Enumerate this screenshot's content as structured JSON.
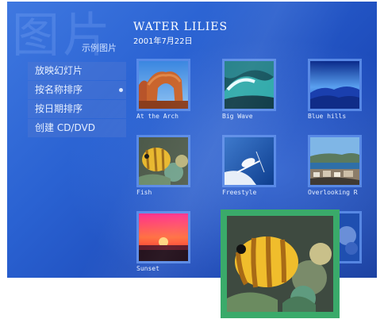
{
  "header": {
    "watermark": "图片",
    "section": "示例图片",
    "album_title": "WATER LILIES",
    "album_date": "2001年7月22日"
  },
  "menu": {
    "items": [
      {
        "label": "放映幻灯片"
      },
      {
        "label": "按名称排序",
        "selected": true
      },
      {
        "label": "按日期排序"
      },
      {
        "label": "创建 CD/DVD"
      }
    ]
  },
  "thumbnails": [
    {
      "caption": "At the Arch",
      "icon": "arch-photo"
    },
    {
      "caption": "Big Wave",
      "icon": "wave-photo"
    },
    {
      "caption": "Blue hills",
      "icon": "hills-photo"
    },
    {
      "caption": "Fish",
      "icon": "fish-photo"
    },
    {
      "caption": "Freestyle",
      "icon": "skier-photo"
    },
    {
      "caption": "Overlooking R",
      "icon": "harbor-photo"
    },
    {
      "caption": "Sunset",
      "icon": "sunset-photo"
    }
  ],
  "zoom_preview": {
    "icon": "fish-photo"
  },
  "colors": {
    "panel": "#2a62d2",
    "thumb_border": "#5f91eb",
    "zoom_frame": "#3aaa6a"
  }
}
